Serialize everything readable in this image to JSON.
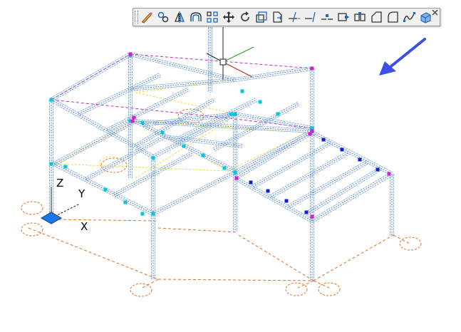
{
  "canvas": {
    "axis_labels": {
      "z": "Z",
      "y": "Y",
      "x": "X"
    }
  },
  "toolbar": {
    "buttons": [
      {
        "icon": "pencil-erase-icon"
      },
      {
        "icon": "copy-icon"
      },
      {
        "icon": "mirror-icon"
      },
      {
        "icon": "offset-icon"
      },
      {
        "icon": "array-icon"
      },
      {
        "icon": "move-icon"
      },
      {
        "icon": "rotate-icon"
      },
      {
        "icon": "scale-icon"
      },
      {
        "icon": "stretch-icon"
      },
      {
        "icon": "trim-icon"
      },
      {
        "icon": "extend-icon"
      },
      {
        "icon": "break-at-point-icon"
      },
      {
        "icon": "break-icon"
      },
      {
        "icon": "join-icon"
      },
      {
        "icon": "chamfer-icon"
      },
      {
        "icon": "fillet-icon"
      },
      {
        "icon": "blend-curves-icon"
      },
      {
        "icon": "explode-icon"
      }
    ]
  },
  "colors": {
    "frame": "#7fa8e0",
    "frame_dark": "#3c78d8",
    "joint": "#00c8e0",
    "magenta": "#d020d0",
    "yellow": "#e8e040",
    "orange": "#e07020",
    "blue_dot": "#1020d0",
    "ucs_blue": "#1878e8",
    "arrow": "#3c50e8"
  }
}
